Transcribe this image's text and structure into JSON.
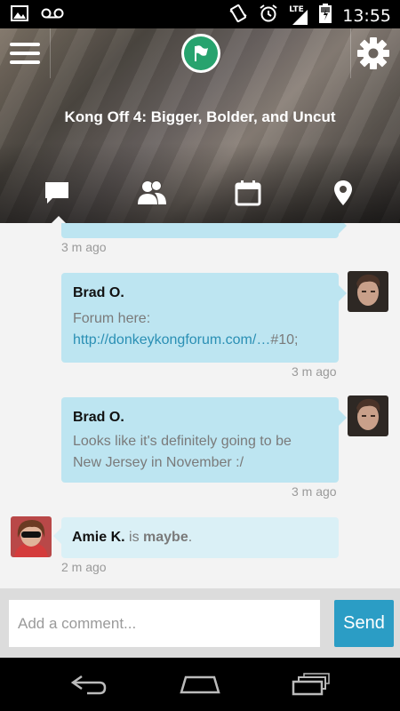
{
  "status_bar": {
    "time": "13:55",
    "network": "LTE",
    "icons": [
      "image-icon",
      "voicemail-icon",
      "vibrate-icon",
      "alarm-icon",
      "signal-icon",
      "battery-icon"
    ]
  },
  "header": {
    "title": "Kong Off 4: Bigger, Bolder, and Uncut",
    "menu_icon": "hamburger-menu-icon",
    "logo_icon": "flag-icon",
    "settings_icon": "gear-icon",
    "tabs": [
      {
        "icon": "chat-bubble-icon",
        "selected": true
      },
      {
        "icon": "people-icon",
        "selected": false
      },
      {
        "icon": "calendar-icon",
        "selected": false
      },
      {
        "icon": "location-pin-icon",
        "selected": false
      }
    ]
  },
  "messages": {
    "partial_time": "3 m ago",
    "items": [
      {
        "author": "Brad O.",
        "text": "Forum here:",
        "link": "http://donkeykongforum.com/…",
        "link_suffix": "#10;",
        "time": "3 m ago"
      },
      {
        "author": "Brad O.",
        "text_line1": "Looks like it's definitely going to be",
        "text_line2": "New Jersey in November :/",
        "time": "3 m ago"
      }
    ],
    "rsvp": {
      "author": "Amie K.",
      "verb": " is ",
      "status": "maybe",
      "period": ".",
      "time": "2 m ago"
    }
  },
  "composer": {
    "placeholder": "Add a comment...",
    "send_label": "Send"
  },
  "colors": {
    "bubble": "#bde5f1",
    "bubble_light": "#daf0f6",
    "link": "#2a8fb4",
    "send_button": "#2b9dc5",
    "logo_green": "#27a36e"
  }
}
